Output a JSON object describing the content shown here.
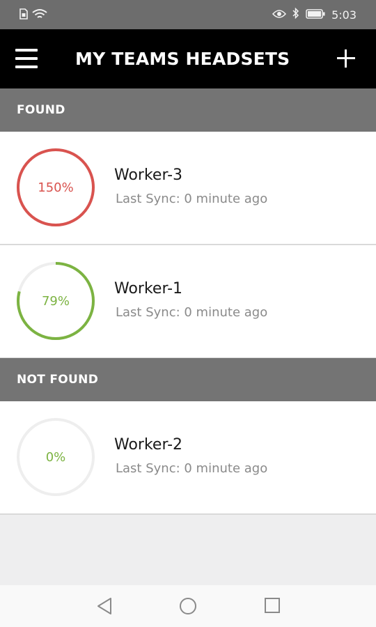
{
  "status_bar": {
    "time": "5:03",
    "icons": [
      "sim-icon",
      "wifi-icon",
      "eye-icon",
      "bluetooth-icon",
      "battery-icon"
    ]
  },
  "app_bar": {
    "title": "MY TEAMS HEADSETS",
    "menu_icon": "menu-icon",
    "add_icon": "plus-icon"
  },
  "sections": [
    {
      "title": "FOUND"
    },
    {
      "title": "NOT FOUND"
    }
  ],
  "workers": [
    {
      "name": "Worker-3",
      "percent_label": "150%",
      "progress": 1.0,
      "color": "#d9534f",
      "sync": "Last Sync: 0  minute ago"
    },
    {
      "name": "Worker-1",
      "percent_label": "79%",
      "progress": 0.79,
      "color": "#7cb342",
      "sync": "Last Sync: 0  minute ago"
    },
    {
      "name": "Worker-2",
      "percent_label": "0%",
      "progress": 0.0,
      "color": "#7cb342",
      "sync": "Last Sync: 0  minute ago"
    }
  ],
  "colors": {
    "ring_track": "#eeeeee",
    "app_bar": "#000000",
    "section_header": "#747474"
  },
  "nav_bar": {
    "icons": [
      "back-icon",
      "home-icon",
      "recents-icon"
    ]
  }
}
